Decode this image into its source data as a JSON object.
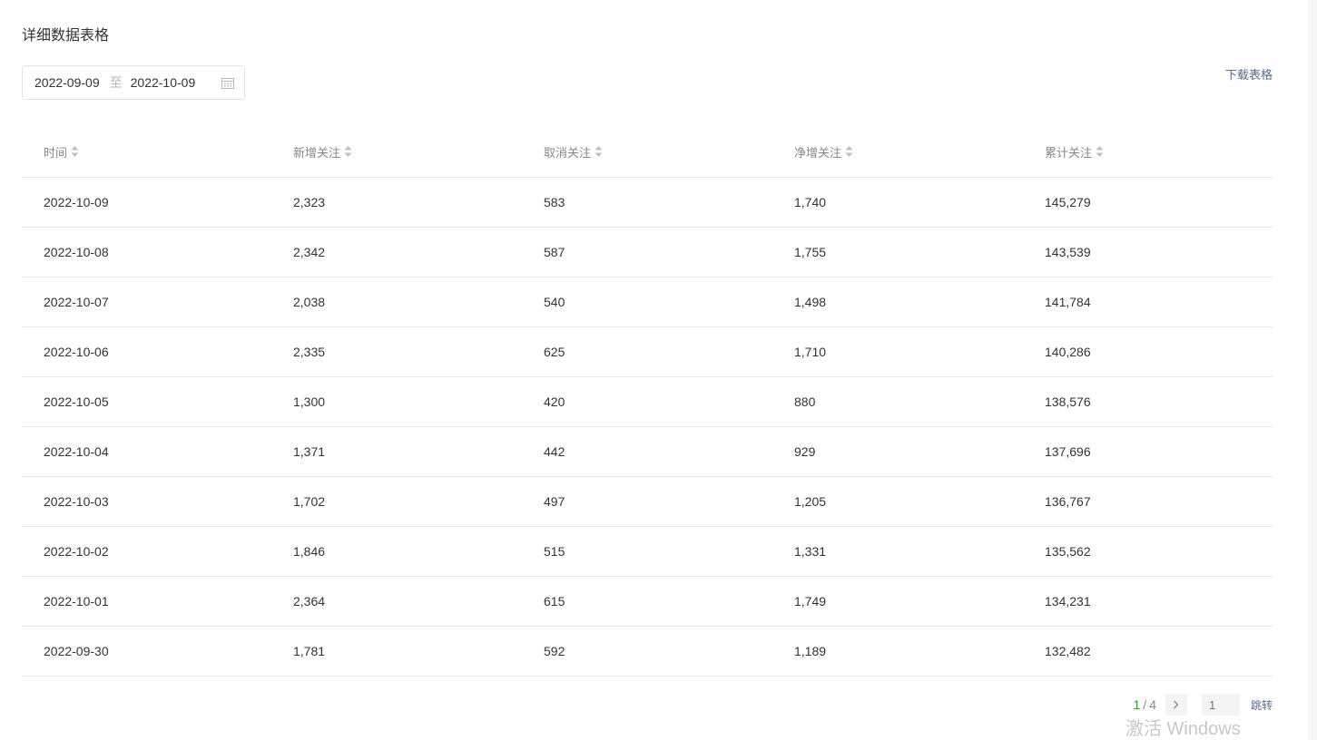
{
  "section": {
    "title": "详细数据表格"
  },
  "date_range": {
    "start": "2022-09-09",
    "separator": "至",
    "end": "2022-10-09"
  },
  "download": {
    "label": "下载表格"
  },
  "table": {
    "headers": [
      "时间",
      "新增关注",
      "取消关注",
      "净增关注",
      "累计关注"
    ],
    "rows": [
      [
        "2022-10-09",
        "2,323",
        "583",
        "1,740",
        "145,279"
      ],
      [
        "2022-10-08",
        "2,342",
        "587",
        "1,755",
        "143,539"
      ],
      [
        "2022-10-07",
        "2,038",
        "540",
        "1,498",
        "141,784"
      ],
      [
        "2022-10-06",
        "2,335",
        "625",
        "1,710",
        "140,286"
      ],
      [
        "2022-10-05",
        "1,300",
        "420",
        "880",
        "138,576"
      ],
      [
        "2022-10-04",
        "1,371",
        "442",
        "929",
        "137,696"
      ],
      [
        "2022-10-03",
        "1,702",
        "497",
        "1,205",
        "136,767"
      ],
      [
        "2022-10-02",
        "1,846",
        "515",
        "1,331",
        "135,562"
      ],
      [
        "2022-10-01",
        "2,364",
        "615",
        "1,749",
        "134,231"
      ],
      [
        "2022-09-30",
        "1,781",
        "592",
        "1,189",
        "132,482"
      ]
    ]
  },
  "pager": {
    "current": "1",
    "slash": "/",
    "total": "4",
    "input_placeholder": "1",
    "jump_label": "跳转"
  },
  "watermark": {
    "text": "激活 Windows"
  },
  "colors": {
    "accent_green": "#1aad19",
    "link_blue": "#576b95",
    "border": "#e7e7e7"
  },
  "icons": {
    "calendar": "calendar-icon",
    "sort": "sort-icon",
    "next": "chevron-right-icon"
  }
}
